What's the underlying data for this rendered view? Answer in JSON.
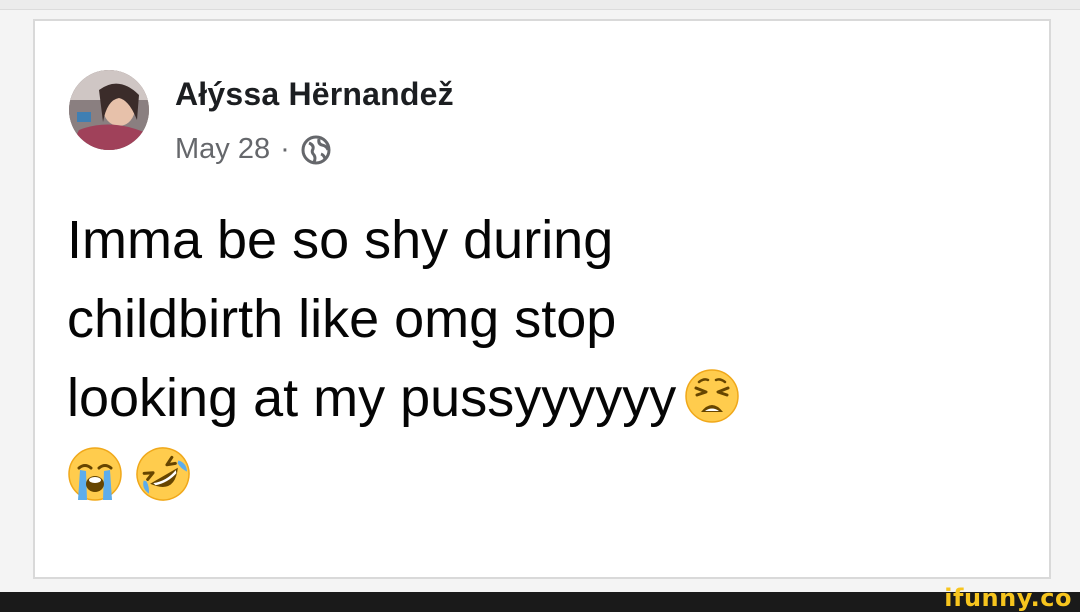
{
  "post": {
    "author": "Ałýssa Hërnandež",
    "date": "May 28",
    "separator": "·",
    "privacy_icon": "globe-icon",
    "text_lines": [
      "Imma be so shy during",
      "childbirth like omg stop",
      "looking at my pussyyyyyy"
    ],
    "emojis": {
      "inline": "weary-face-emoji",
      "row": [
        "loudly-crying-face-emoji",
        "rolling-on-floor-laughing-emoji"
      ]
    }
  },
  "watermark": "ifunny.co",
  "colors": {
    "card_background": "#ffffff",
    "text_primary": "#050505",
    "text_secondary": "#65676b",
    "watermark": "#f7c51e"
  }
}
